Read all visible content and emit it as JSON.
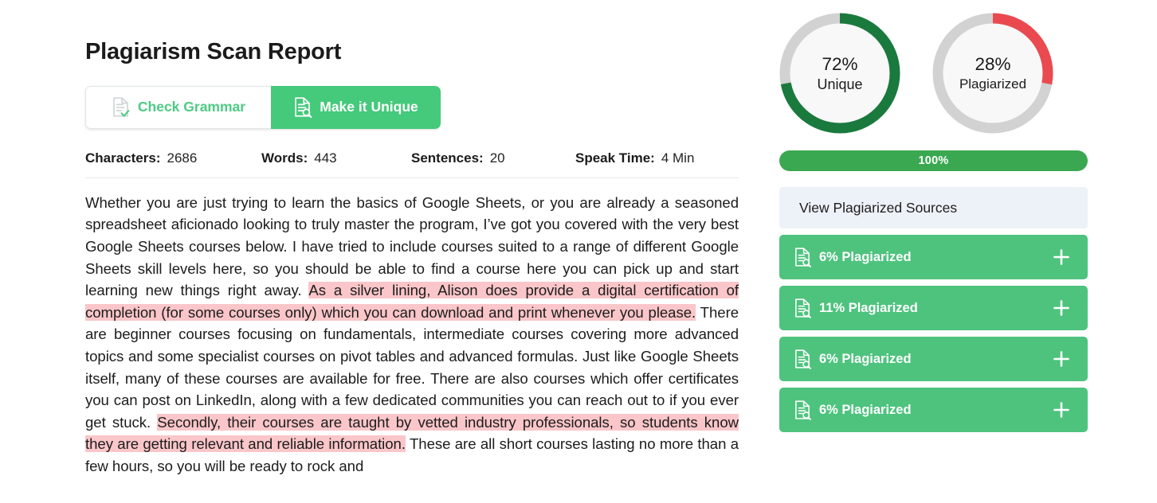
{
  "header": {
    "title": "Plagiarism Scan Report"
  },
  "toolbar": {
    "grammar_label": "Check Grammar",
    "grammar_icon": "document-check-icon",
    "unique_label": "Make it Unique",
    "unique_icon": "document-search-icon",
    "accent_green": "#45c97b",
    "grammar_text_color": "#4ecb84"
  },
  "stats": [
    {
      "label": "Characters:",
      "value": "2686"
    },
    {
      "label": "Words:",
      "value": "443"
    },
    {
      "label": "Sentences:",
      "value": "20"
    },
    {
      "label": "Speak Time:",
      "value": "4 Min"
    }
  ],
  "body": {
    "segments": [
      {
        "text": "Whether you are just trying to learn the basics of Google Sheets, or you are already a seasoned spreadsheet aficionado looking to truly master the program, I’ve got you covered with the very best Google Sheets courses below. I have tried to include courses suited to a range of different Google Sheets skill levels here, so you should be able to find a course here you can pick up and start learning new things right away. ",
        "highlight": false
      },
      {
        "text": "As a silver lining, Alison does provide a digital certification of completion (for some courses only) which you can download and print whenever you please.",
        "highlight": true
      },
      {
        "text": " There are beginner courses focusing on fundamentals, intermediate courses covering more advanced topics and some specialist courses on pivot tables and advanced formulas. Just like Google Sheets itself, many of these courses are available for free. There are also courses which offer certificates you can post on LinkedIn, along with a few dedicated communities you can reach out to if you ever get stuck. ",
        "highlight": false
      },
      {
        "text": "Secondly, their courses are taught by vetted industry professionals, so students know they are getting relevant and reliable information.",
        "highlight": true
      },
      {
        "text": " These are all short courses lasting no more than a few hours, so you will be ready to rock and",
        "highlight": false
      }
    ],
    "highlight_color": "#fac6c9"
  },
  "chart_data": [
    {
      "type": "pie",
      "title": "Unique",
      "percent_label": "72%",
      "label": "Unique",
      "values": [
        72,
        28
      ],
      "categories": [
        "Unique",
        "Remaining"
      ],
      "colors": [
        "#1a7a3e",
        "#d2d2d2"
      ],
      "start_angle": 0,
      "direction": "clockwise"
    },
    {
      "type": "pie",
      "title": "Plagiarized",
      "percent_label": "28%",
      "label": "Plagiarized",
      "values": [
        28,
        72
      ],
      "categories": [
        "Plagiarized",
        "Remaining"
      ],
      "colors": [
        "#ea4a4f",
        "#d2d2d2"
      ],
      "start_angle": 0,
      "direction": "clockwise"
    }
  ],
  "progress": {
    "text": "100%",
    "value": 100,
    "color": "#3aa851"
  },
  "sources": {
    "header_label": "View Plagiarized Sources",
    "items": [
      {
        "label": "6% Plagiarized",
        "percent": 6,
        "icon": "document-search-icon",
        "expand_icon": "plus-icon"
      },
      {
        "label": "11% Plagiarized",
        "percent": 11,
        "icon": "document-search-icon",
        "expand_icon": "plus-icon"
      },
      {
        "label": "6% Plagiarized",
        "percent": 6,
        "icon": "document-search-icon",
        "expand_icon": "plus-icon"
      },
      {
        "label": "6% Plagiarized",
        "percent": 6,
        "icon": "document-search-icon",
        "expand_icon": "plus-icon"
      }
    ],
    "row_color": "#4ec37e",
    "header_bg": "#edf1f8"
  }
}
